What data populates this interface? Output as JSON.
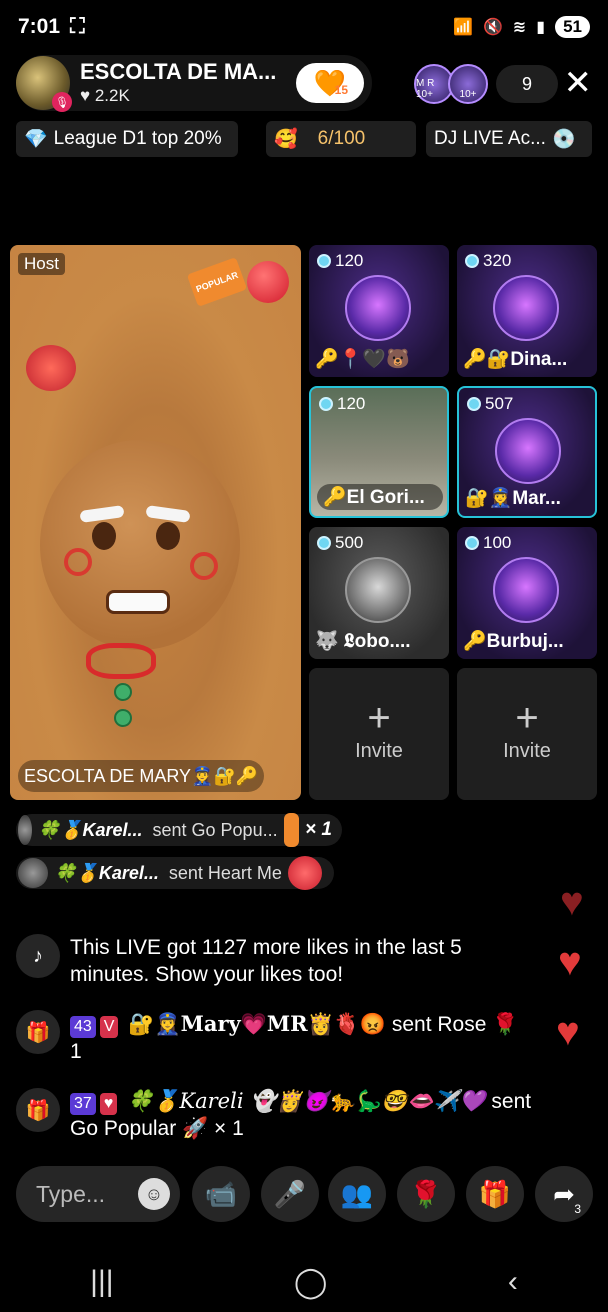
{
  "status": {
    "time": "7:01",
    "battery": "51"
  },
  "host": {
    "name": "ESCOLTA DE MA...",
    "likes": "2.2K",
    "follow_count": "15"
  },
  "viewers": {
    "avatars": [
      "M R 10+",
      "10+"
    ],
    "count": "9"
  },
  "chips": {
    "league": "League D1 top 20%",
    "progress": "6/100",
    "dj": "DJ LIVE Ac..."
  },
  "host_video": {
    "tag": "Host",
    "popular_text": "POPULAR",
    "caption": "ESCOLTA DE MARY👮‍♀️🔐🔑"
  },
  "guests": [
    {
      "score": "120",
      "name": "🔑📍🖤🐻"
    },
    {
      "score": "320",
      "name": "🔑🔐Dina..."
    },
    {
      "score": "120",
      "name": "🔑El Gori..."
    },
    {
      "score": "507",
      "name": "🔐👮‍♀️Mar..."
    },
    {
      "score": "500",
      "name": "🐺 𝕷obo...."
    },
    {
      "score": "100",
      "name": "🔑Burbuj..."
    }
  ],
  "invite": {
    "label": "Invite"
  },
  "gifts": [
    {
      "user": "🍀🥇Karel...",
      "text": "sent Go Popu...",
      "combo": "× 1"
    },
    {
      "user": "🍀🥇Karel...",
      "text": "sent Heart Me"
    }
  ],
  "chat": {
    "system_msg": "This LIVE got 1127 more likes in the last 5 minutes. Show your likes too!",
    "msg1": {
      "level": "43",
      "user": "🔐👮‍♀️Mary💗MR👸🫀😡",
      "action": "sent Rose 🌹",
      "count": "1"
    },
    "msg2": {
      "level": "37",
      "user": "🍀🥇Kareli 👻👸😈🐆🦕🤓👄✈️💜",
      "action": "sent",
      "gift": "Go Popular 🚀 × 1"
    }
  },
  "bottom": {
    "placeholder": "Type...",
    "share_count": "3"
  },
  "colors": {
    "accent_cyan": "#27c3d8",
    "host_bg": "#c48240",
    "heart": "#e23a3a"
  },
  "icons": [
    "search",
    "mute",
    "wifi",
    "signal",
    "video-off-icon",
    "mic-icon",
    "guests-icon",
    "rose-icon",
    "gift-icon",
    "share-icon"
  ]
}
